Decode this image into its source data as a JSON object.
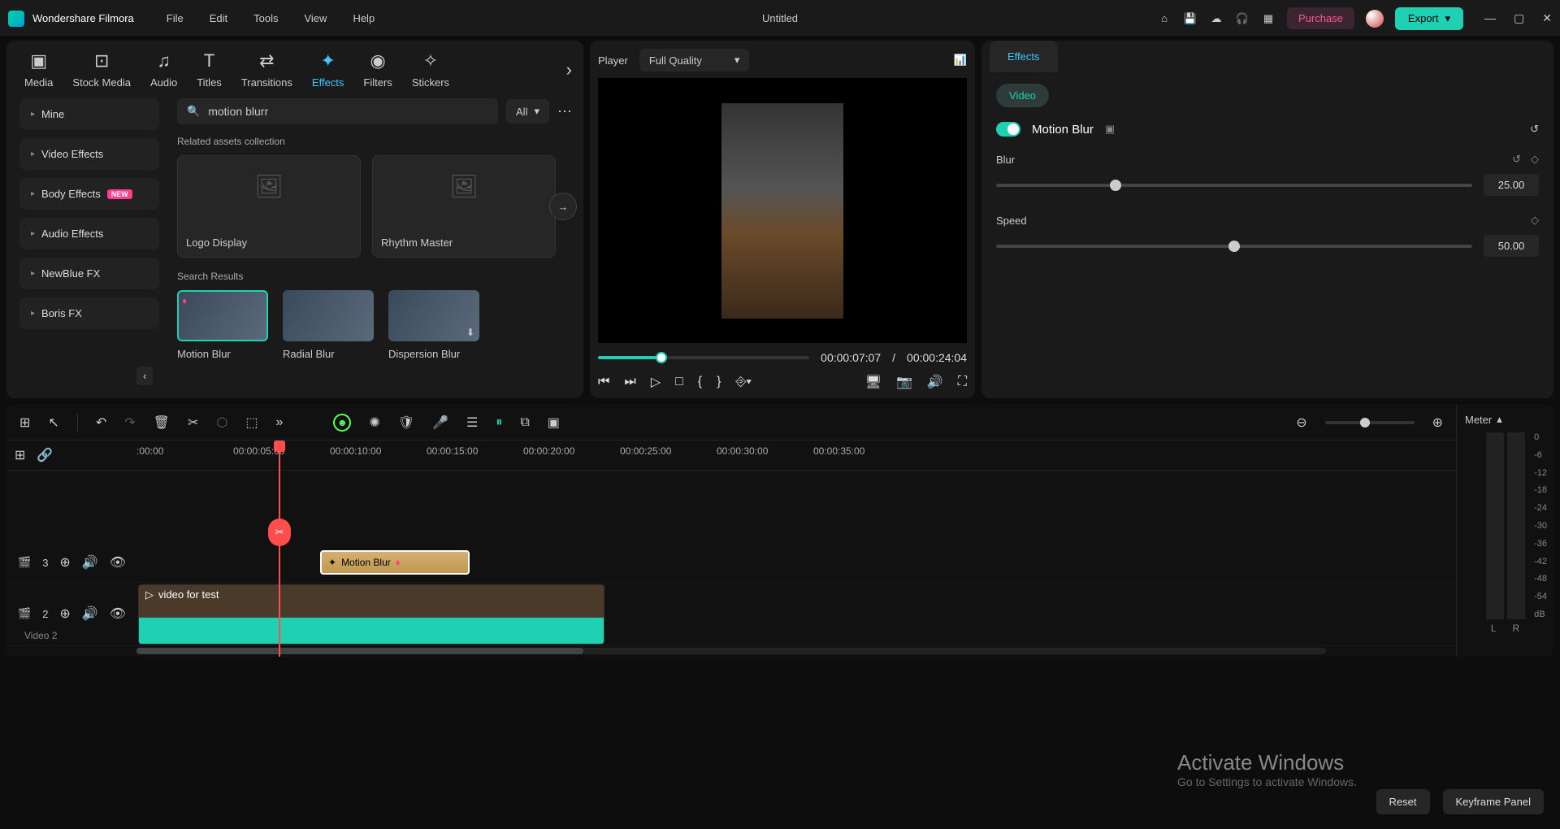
{
  "app": {
    "name": "Wondershare Filmora",
    "document": "Untitled"
  },
  "menu": [
    "File",
    "Edit",
    "Tools",
    "View",
    "Help"
  ],
  "titlebar": {
    "purchase": "Purchase",
    "export": "Export"
  },
  "library": {
    "tabs": [
      "Media",
      "Stock Media",
      "Audio",
      "Titles",
      "Transitions",
      "Effects",
      "Filters",
      "Stickers"
    ],
    "active_tab": "Effects",
    "categories": [
      {
        "label": "Mine"
      },
      {
        "label": "Video Effects"
      },
      {
        "label": "Body Effects",
        "badge": "NEW"
      },
      {
        "label": "Audio Effects"
      },
      {
        "label": "NewBlue FX"
      },
      {
        "label": "Boris FX"
      }
    ],
    "search": {
      "value": "motion blurr",
      "filter": "All"
    },
    "related_title": "Related assets collection",
    "related": [
      "Logo Display",
      "Rhythm Master"
    ],
    "results_title": "Search Results",
    "results": [
      "Motion Blur",
      "Radial Blur",
      "Dispersion Blur"
    ]
  },
  "player": {
    "label": "Player",
    "quality": "Full Quality",
    "current_time": "00:00:07:07",
    "sep": "/",
    "duration": "00:00:24:04"
  },
  "effects_panel": {
    "tab": "Effects",
    "sub_tab": "Video",
    "effect_name": "Motion Blur",
    "props": {
      "blur": {
        "label": "Blur",
        "value": "25.00"
      },
      "speed": {
        "label": "Speed",
        "value": "50.00"
      }
    }
  },
  "timeline": {
    "ruler": [
      ":00:00",
      "00:00:05:00",
      "00:00:10:00",
      "00:00:15:00",
      "00:00:20:00",
      "00:00:25:00",
      "00:00:30:00",
      "00:00:35:00"
    ],
    "meter_label": "Meter",
    "meter_scale": [
      "0",
      "-6",
      "-12",
      "-18",
      "-24",
      "-30",
      "-36",
      "-42",
      "-48",
      "-54",
      "dB"
    ],
    "meter_lr": [
      "L",
      "R"
    ],
    "tracks": {
      "fx": {
        "num": "3",
        "clip_label": "Motion Blur"
      },
      "video": {
        "num": "2",
        "clip_label": "video for test",
        "track_label": "Video 2"
      }
    }
  },
  "footer": {
    "reset": "Reset",
    "keyframe": "Keyframe Panel"
  },
  "watermark": {
    "line1": "Activate Windows",
    "line2": "Go to Settings to activate Windows."
  }
}
